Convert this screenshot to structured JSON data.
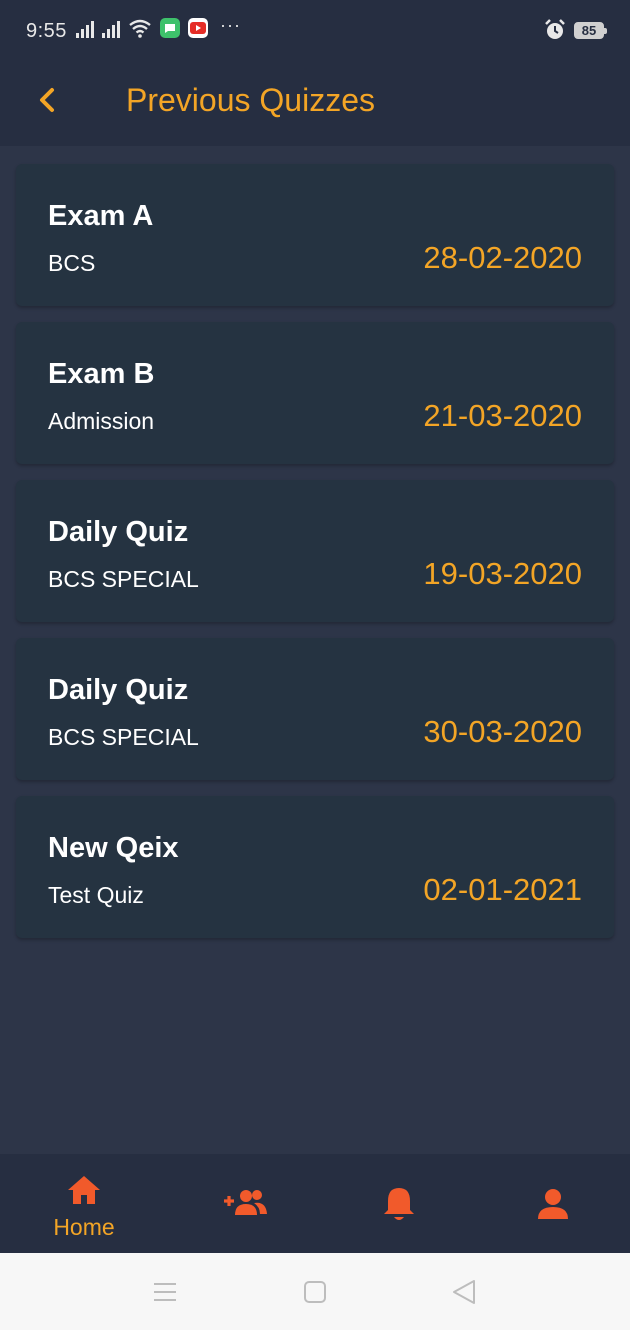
{
  "status_bar": {
    "time": "9:55",
    "battery": "85",
    "icons": [
      "signal-icon",
      "signal-icon",
      "wifi-icon",
      "message-app-icon",
      "youtube-app-icon",
      "more-dots-icon",
      "alarm-icon",
      "battery-icon"
    ]
  },
  "header": {
    "title": "Previous Quizzes",
    "back_icon": "chevron-left-icon"
  },
  "quizzes": [
    {
      "title": "Exam A",
      "subtitle": "BCS",
      "date": "28-02-2020"
    },
    {
      "title": "Exam B",
      "subtitle": "Admission",
      "date": "21-03-2020"
    },
    {
      "title": "Daily Quiz",
      "subtitle": "BCS SPECIAL",
      "date": "19-03-2020"
    },
    {
      "title": "Daily Quiz",
      "subtitle": "BCS SPECIAL",
      "date": "30-03-2020"
    },
    {
      "title": "New Qeix",
      "subtitle": "Test Quiz",
      "date": "02-01-2021"
    }
  ],
  "bottom_nav": {
    "items": [
      {
        "icon": "home-icon",
        "label": "Home",
        "active": true
      },
      {
        "icon": "add-friend-icon",
        "label": ""
      },
      {
        "icon": "bell-icon",
        "label": ""
      },
      {
        "icon": "user-icon",
        "label": ""
      }
    ]
  },
  "system_nav": {
    "items": [
      "menu-icon",
      "home-square-icon",
      "back-triangle-icon"
    ]
  },
  "colors": {
    "accent": "#f3a526",
    "nav_icon": "#f15a2b",
    "background": "#2d3548",
    "header": "#262e41",
    "card": "#253341"
  }
}
